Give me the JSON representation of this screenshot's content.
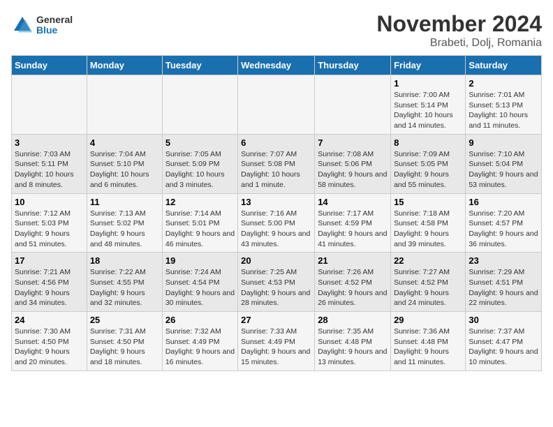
{
  "logo": {
    "general": "General",
    "blue": "Blue"
  },
  "title": "November 2024",
  "location": "Brabeti, Dolj, Romania",
  "weekdays": [
    "Sunday",
    "Monday",
    "Tuesday",
    "Wednesday",
    "Thursday",
    "Friday",
    "Saturday"
  ],
  "weeks": [
    [
      {
        "day": "",
        "info": ""
      },
      {
        "day": "",
        "info": ""
      },
      {
        "day": "",
        "info": ""
      },
      {
        "day": "",
        "info": ""
      },
      {
        "day": "",
        "info": ""
      },
      {
        "day": "1",
        "info": "Sunrise: 7:00 AM\nSunset: 5:14 PM\nDaylight: 10 hours and 14 minutes."
      },
      {
        "day": "2",
        "info": "Sunrise: 7:01 AM\nSunset: 5:13 PM\nDaylight: 10 hours and 11 minutes."
      }
    ],
    [
      {
        "day": "3",
        "info": "Sunrise: 7:03 AM\nSunset: 5:11 PM\nDaylight: 10 hours and 8 minutes."
      },
      {
        "day": "4",
        "info": "Sunrise: 7:04 AM\nSunset: 5:10 PM\nDaylight: 10 hours and 6 minutes."
      },
      {
        "day": "5",
        "info": "Sunrise: 7:05 AM\nSunset: 5:09 PM\nDaylight: 10 hours and 3 minutes."
      },
      {
        "day": "6",
        "info": "Sunrise: 7:07 AM\nSunset: 5:08 PM\nDaylight: 10 hours and 1 minute."
      },
      {
        "day": "7",
        "info": "Sunrise: 7:08 AM\nSunset: 5:06 PM\nDaylight: 9 hours and 58 minutes."
      },
      {
        "day": "8",
        "info": "Sunrise: 7:09 AM\nSunset: 5:05 PM\nDaylight: 9 hours and 55 minutes."
      },
      {
        "day": "9",
        "info": "Sunrise: 7:10 AM\nSunset: 5:04 PM\nDaylight: 9 hours and 53 minutes."
      }
    ],
    [
      {
        "day": "10",
        "info": "Sunrise: 7:12 AM\nSunset: 5:03 PM\nDaylight: 9 hours and 51 minutes."
      },
      {
        "day": "11",
        "info": "Sunrise: 7:13 AM\nSunset: 5:02 PM\nDaylight: 9 hours and 48 minutes."
      },
      {
        "day": "12",
        "info": "Sunrise: 7:14 AM\nSunset: 5:01 PM\nDaylight: 9 hours and 46 minutes."
      },
      {
        "day": "13",
        "info": "Sunrise: 7:16 AM\nSunset: 5:00 PM\nDaylight: 9 hours and 43 minutes."
      },
      {
        "day": "14",
        "info": "Sunrise: 7:17 AM\nSunset: 4:59 PM\nDaylight: 9 hours and 41 minutes."
      },
      {
        "day": "15",
        "info": "Sunrise: 7:18 AM\nSunset: 4:58 PM\nDaylight: 9 hours and 39 minutes."
      },
      {
        "day": "16",
        "info": "Sunrise: 7:20 AM\nSunset: 4:57 PM\nDaylight: 9 hours and 36 minutes."
      }
    ],
    [
      {
        "day": "17",
        "info": "Sunrise: 7:21 AM\nSunset: 4:56 PM\nDaylight: 9 hours and 34 minutes."
      },
      {
        "day": "18",
        "info": "Sunrise: 7:22 AM\nSunset: 4:55 PM\nDaylight: 9 hours and 32 minutes."
      },
      {
        "day": "19",
        "info": "Sunrise: 7:24 AM\nSunset: 4:54 PM\nDaylight: 9 hours and 30 minutes."
      },
      {
        "day": "20",
        "info": "Sunrise: 7:25 AM\nSunset: 4:53 PM\nDaylight: 9 hours and 28 minutes."
      },
      {
        "day": "21",
        "info": "Sunrise: 7:26 AM\nSunset: 4:52 PM\nDaylight: 9 hours and 26 minutes."
      },
      {
        "day": "22",
        "info": "Sunrise: 7:27 AM\nSunset: 4:52 PM\nDaylight: 9 hours and 24 minutes."
      },
      {
        "day": "23",
        "info": "Sunrise: 7:29 AM\nSunset: 4:51 PM\nDaylight: 9 hours and 22 minutes."
      }
    ],
    [
      {
        "day": "24",
        "info": "Sunrise: 7:30 AM\nSunset: 4:50 PM\nDaylight: 9 hours and 20 minutes."
      },
      {
        "day": "25",
        "info": "Sunrise: 7:31 AM\nSunset: 4:50 PM\nDaylight: 9 hours and 18 minutes."
      },
      {
        "day": "26",
        "info": "Sunrise: 7:32 AM\nSunset: 4:49 PM\nDaylight: 9 hours and 16 minutes."
      },
      {
        "day": "27",
        "info": "Sunrise: 7:33 AM\nSunset: 4:49 PM\nDaylight: 9 hours and 15 minutes."
      },
      {
        "day": "28",
        "info": "Sunrise: 7:35 AM\nSunset: 4:48 PM\nDaylight: 9 hours and 13 minutes."
      },
      {
        "day": "29",
        "info": "Sunrise: 7:36 AM\nSunset: 4:48 PM\nDaylight: 9 hours and 11 minutes."
      },
      {
        "day": "30",
        "info": "Sunrise: 7:37 AM\nSunset: 4:47 PM\nDaylight: 9 hours and 10 minutes."
      }
    ]
  ]
}
